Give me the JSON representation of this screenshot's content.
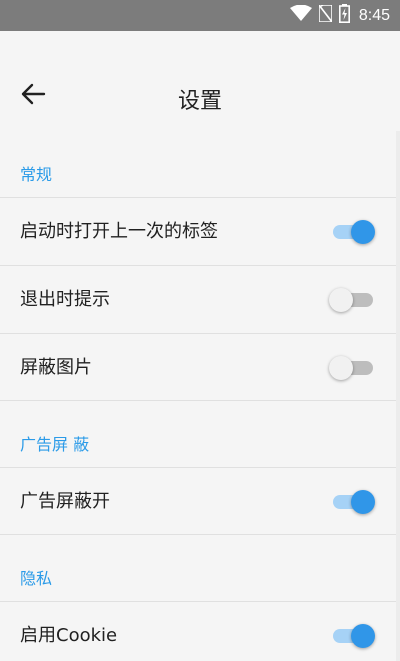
{
  "status_bar": {
    "time": "8:45",
    "icons": [
      "wifi-icon",
      "no-sim-icon",
      "battery-charging-icon"
    ]
  },
  "app_bar": {
    "back_icon": "arrow-back-icon",
    "title": "设置"
  },
  "sections": [
    {
      "header": "常规",
      "items": [
        {
          "label": "启动时打开上一次的标签",
          "enabled": true
        },
        {
          "label": "退出时提示",
          "enabled": false
        },
        {
          "label": "屏蔽图片",
          "enabled": false
        }
      ]
    },
    {
      "header": "广告屏 蔽",
      "items": [
        {
          "label": "广告屏蔽开",
          "enabled": true
        }
      ]
    },
    {
      "header": "隐私",
      "items": [
        {
          "label": "启用Cookie",
          "enabled": true
        }
      ]
    }
  ],
  "colors": {
    "accent": "#3096e8",
    "section_header": "#2b9be8",
    "status_bar": "#7c7c7c"
  }
}
